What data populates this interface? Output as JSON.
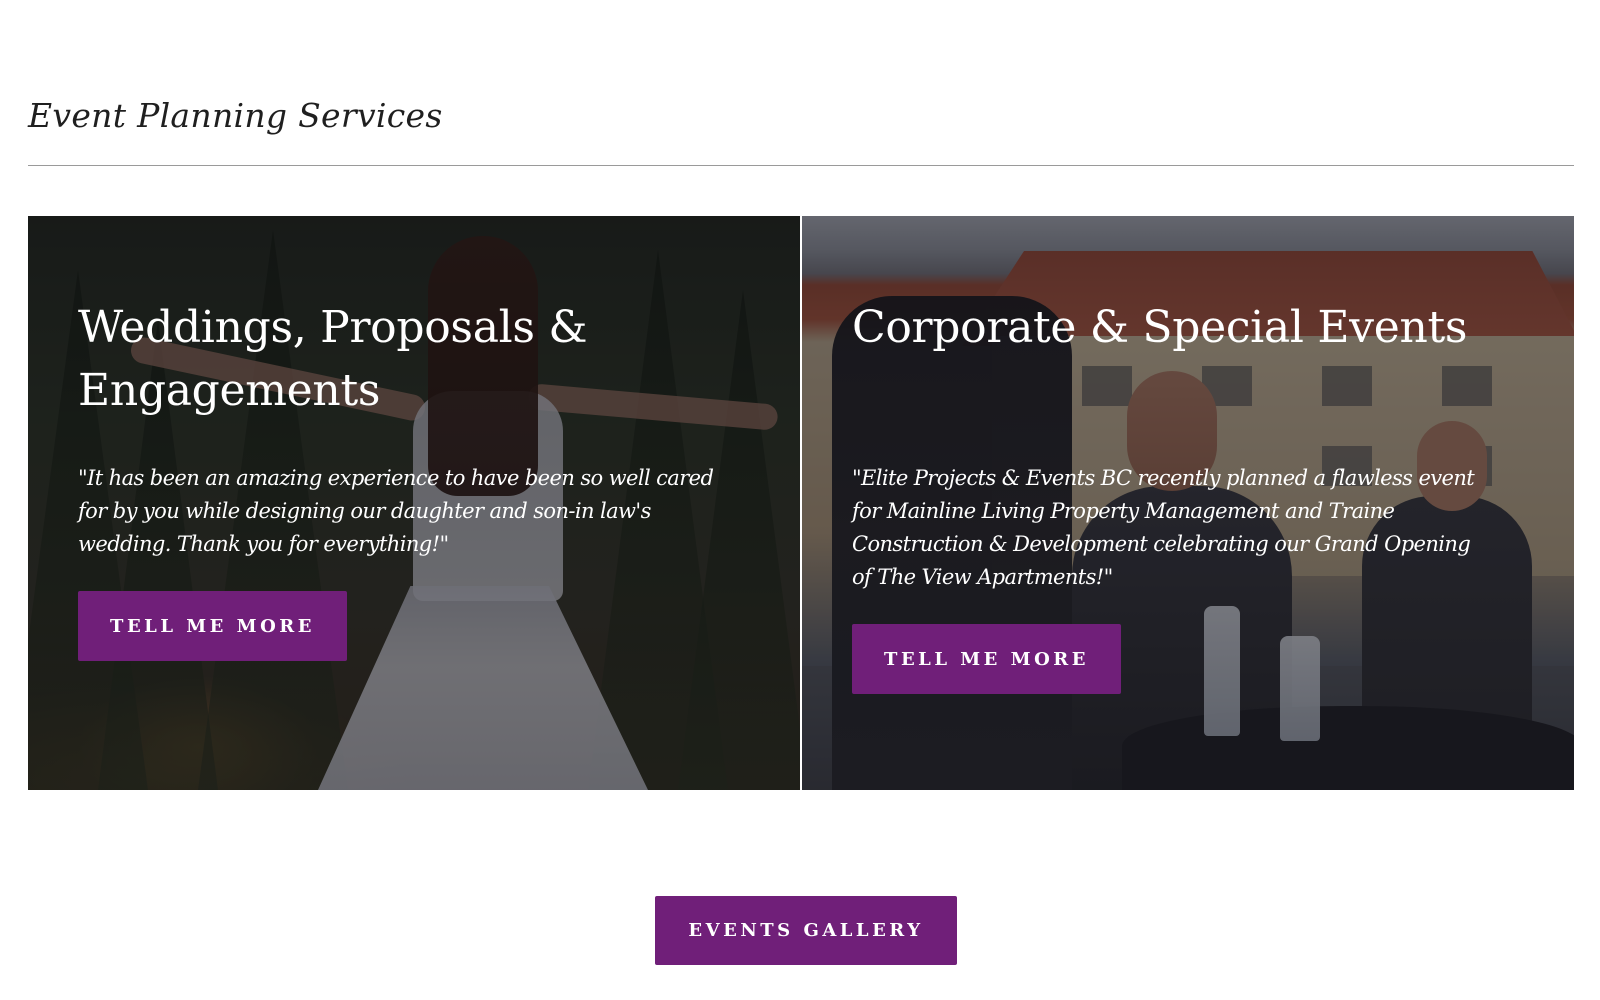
{
  "section": {
    "title": "Event Planning Services"
  },
  "cards": [
    {
      "title": "Weddings, Proposals & Engagements",
      "quote": "\"It has been an amazing experience to have been so well cared for by you while designing our daughter and son-in law's wedding.  Thank you for everything!\"",
      "button_label": "TELL ME MORE"
    },
    {
      "title": "Corporate & Special Events",
      "quote": "\"Elite Projects & Events BC recently planned a flawless event for Mainline Living Property Management and Traine Construction & Development celebrating our Grand Opening of The View Apartments!\"",
      "button_label": "TELL ME MORE"
    }
  ],
  "gallery_button": {
    "label": "EVENTS GALLERY"
  },
  "colors": {
    "accent": "#701f79",
    "divider": "#9a9a9a",
    "text_dark": "#1f1f1f"
  }
}
